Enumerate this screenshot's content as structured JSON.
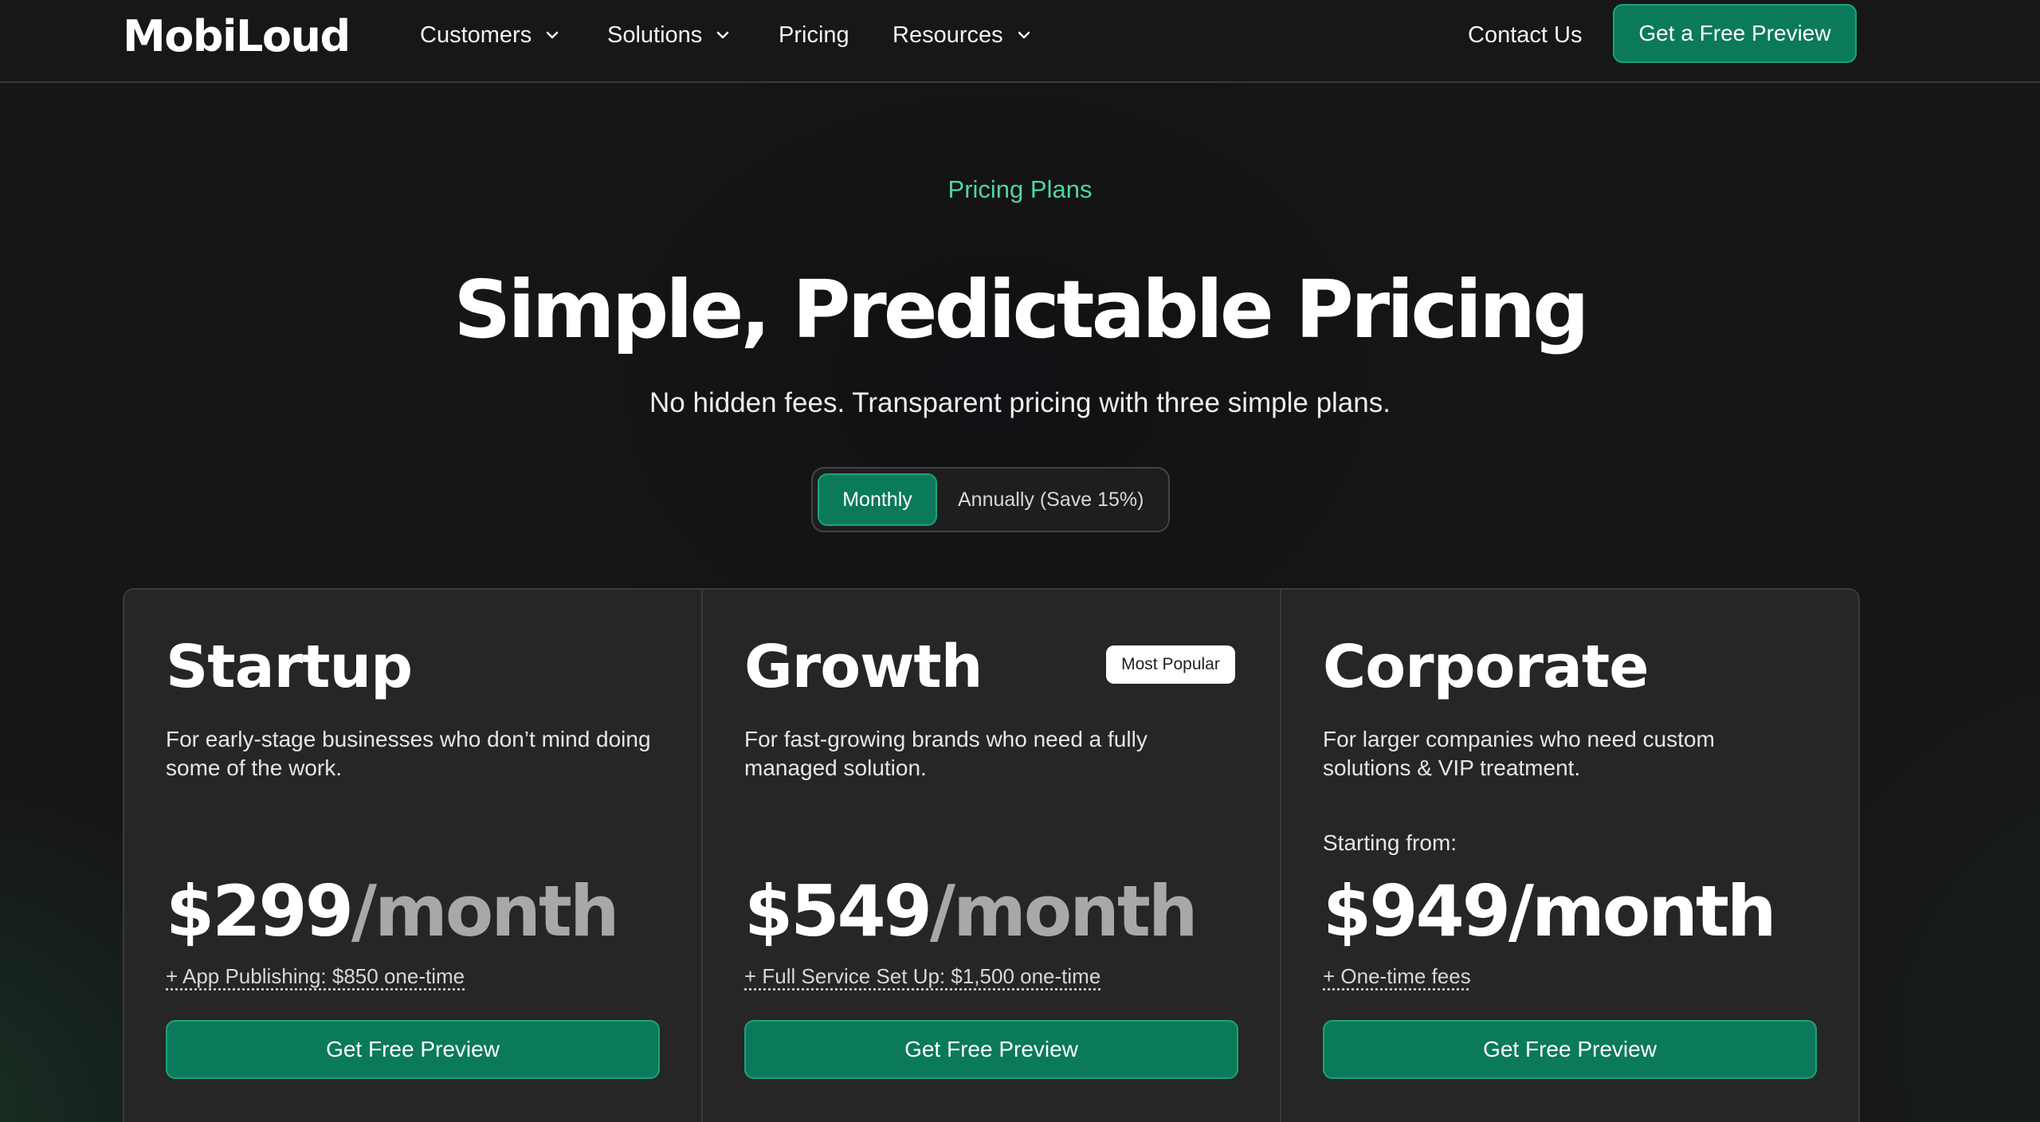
{
  "nav": {
    "logo": "MobiLoud",
    "items": [
      {
        "label": "Customers",
        "has_dropdown": true
      },
      {
        "label": "Solutions",
        "has_dropdown": true
      },
      {
        "label": "Pricing",
        "has_dropdown": false
      },
      {
        "label": "Resources",
        "has_dropdown": true
      }
    ],
    "contact_label": "Contact Us",
    "cta_label": "Get a Free Preview",
    "icon": "chevron-down-icon"
  },
  "hero": {
    "eyebrow": "Pricing Plans",
    "title": "Simple, Predictable Pricing",
    "subtitle": "No hidden fees. Transparent pricing with three simple plans."
  },
  "billing_toggle": {
    "options": [
      "Monthly",
      "Annually (Save 15%)"
    ],
    "selected": "Monthly"
  },
  "plans": [
    {
      "name": "Startup",
      "description": "For early-stage businesses who don’t mind doing some of the work.",
      "price": "$299",
      "period": "/month",
      "fee_note": "+ App Publishing: $850 one-time",
      "cta_label": "Get Free Preview"
    },
    {
      "name": "Growth",
      "badge": "Most Popular",
      "description": "For fast-growing brands who need a fully managed solution.",
      "price": "$549",
      "period": "/month",
      "fee_note": "+ Full Service Set Up: $1,500 one-time",
      "cta_label": "Get Free Preview"
    },
    {
      "name": "Corporate",
      "description": "For larger companies who need custom solutions & VIP treatment.",
      "starting_label": "Starting from:",
      "price": "$949",
      "period": "/month",
      "fee_note": "+ One-time fees",
      "cta_label": "Get Free Preview"
    }
  ],
  "colors": {
    "accent": "#0b7a5a",
    "accent_border": "#1aa478",
    "eyebrow": "#4fd69f",
    "background": "#161616",
    "card": "#262626"
  }
}
